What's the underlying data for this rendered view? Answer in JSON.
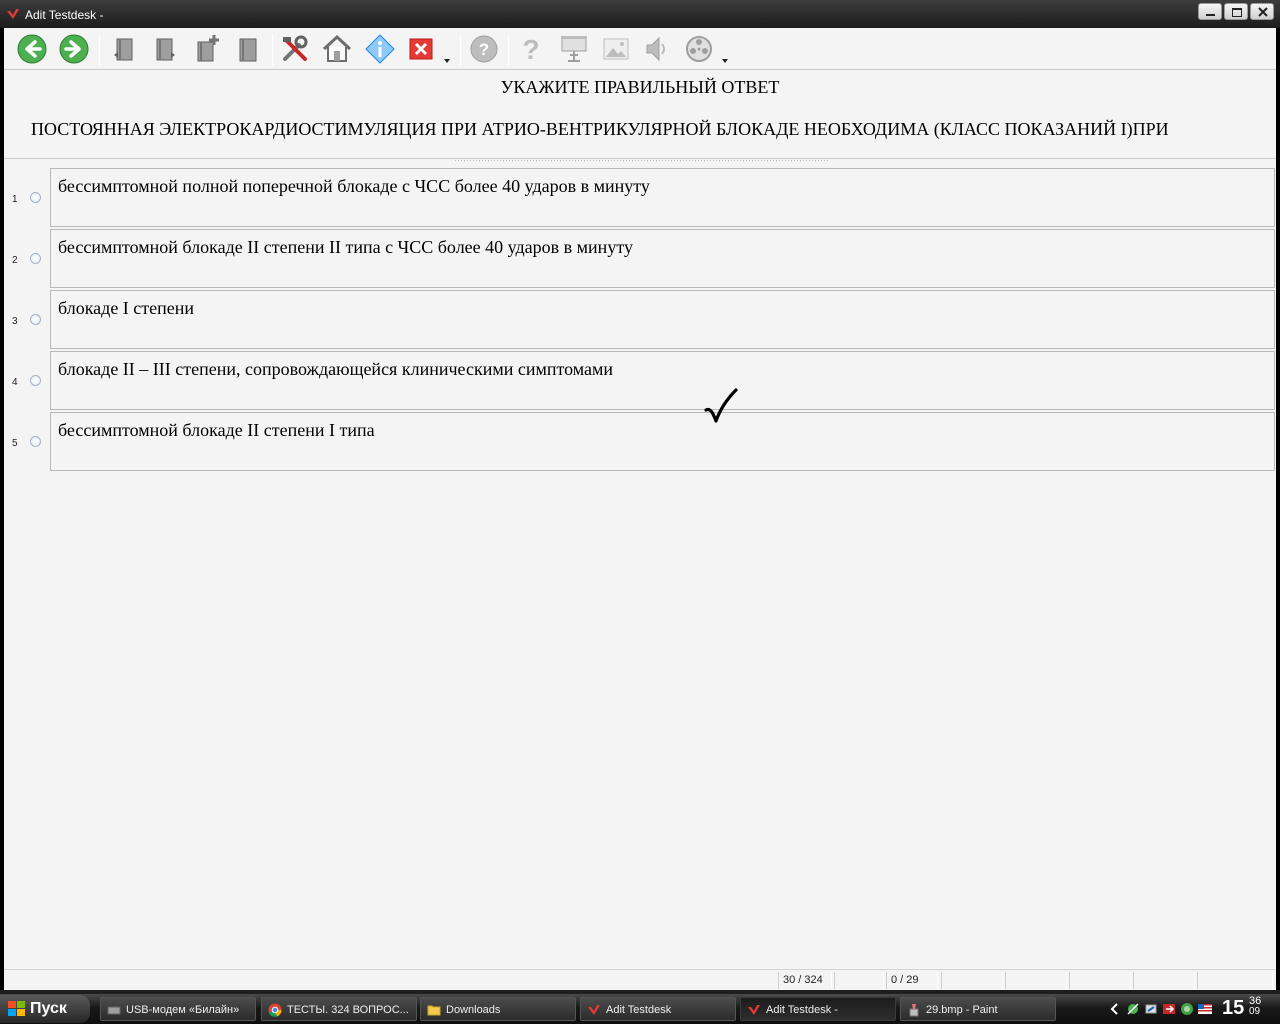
{
  "window": {
    "title": "Adit Testdesk -"
  },
  "toolbar": {
    "buttons": [
      {
        "icon": "back-icon"
      },
      {
        "icon": "forward-icon"
      },
      {
        "icon": "book-prev-icon"
      },
      {
        "icon": "book-next-icon"
      },
      {
        "icon": "book-add-icon"
      },
      {
        "icon": "book-icon"
      },
      {
        "icon": "tools-icon"
      },
      {
        "icon": "home-icon"
      },
      {
        "icon": "info-icon"
      },
      {
        "icon": "close-icon"
      },
      {
        "icon": "help-icon"
      },
      {
        "icon": "hint-icon"
      },
      {
        "icon": "presentation-icon"
      },
      {
        "icon": "image-icon"
      },
      {
        "icon": "speaker-icon"
      },
      {
        "icon": "film-icon"
      }
    ]
  },
  "question": {
    "heading": "УКАЖИТЕ ПРАВИЛЬНЫЙ ОТВЕТ",
    "text": "ПОСТОЯННАЯ ЭЛЕКТРОКАРДИОСТИМУЛЯЦИЯ ПРИ АТРИО-ВЕНТРИКУЛЯРНОЙ БЛОКАДЕ   НЕОБХОДИМА (КЛАСС ПОКАЗАНИЙ I)ПРИ"
  },
  "answers": [
    {
      "number": "1",
      "text": "бессимптомной полной поперечной блокаде с ЧСС более 40 ударов в минуту"
    },
    {
      "number": "2",
      "text": "бессимптомной блокаде II степени II типа с ЧСС более 40 ударов в минуту"
    },
    {
      "number": "3",
      "text": "блокаде I степени"
    },
    {
      "number": "4",
      "text": "блокаде II – III степени, сопровождающейся  клиническими симптомами"
    },
    {
      "number": "5",
      "text": "бессимптомной блокаде II степени I типа"
    }
  ],
  "status": {
    "question_progress": "30 / 324",
    "score": "0 / 29"
  },
  "taskbar": {
    "start_label": "Пуск",
    "tasks": [
      {
        "label": "USB-модем «Билайн»"
      },
      {
        "label": "ТЕСТЫ. 324 ВОПРОС..."
      },
      {
        "label": "Downloads"
      },
      {
        "label": "Adit Testdesk"
      },
      {
        "label": "Adit Testdesk -"
      },
      {
        "label": "29.bmp - Paint"
      }
    ],
    "clock": {
      "hours": "15",
      "minutes": "36",
      "seconds": "09"
    }
  },
  "colors": {
    "window_bg": "#f4f4f4",
    "titlebar": "#2a2a2a",
    "accent_red": "#c62828"
  }
}
